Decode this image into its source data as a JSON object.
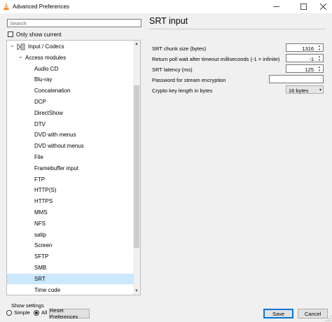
{
  "window": {
    "title": "Advanced Preferences"
  },
  "search": {
    "placeholder": "Search"
  },
  "only_show_current": "Only show current",
  "tree": {
    "items": [
      {
        "label": "Input / Codecs",
        "level": 1,
        "expanded": true,
        "icon": "codec-icon"
      },
      {
        "label": "Access modules",
        "level": 2,
        "expanded": true
      },
      {
        "label": "Audio CD",
        "level": 3
      },
      {
        "label": "Blu-ray",
        "level": 3
      },
      {
        "label": "Concatenation",
        "level": 3
      },
      {
        "label": "DCP",
        "level": 3
      },
      {
        "label": "DirectShow",
        "level": 3
      },
      {
        "label": "DTV",
        "level": 3
      },
      {
        "label": "DVD with menus",
        "level": 3
      },
      {
        "label": "DVD without menus",
        "level": 3
      },
      {
        "label": "File",
        "level": 3
      },
      {
        "label": "Framebuffer input",
        "level": 3
      },
      {
        "label": "FTP",
        "level": 3
      },
      {
        "label": "HTTP(S)",
        "level": 3
      },
      {
        "label": "HTTPS",
        "level": 3
      },
      {
        "label": "MMS",
        "level": 3
      },
      {
        "label": "NFS",
        "level": 3
      },
      {
        "label": "satip",
        "level": 3
      },
      {
        "label": "Screen",
        "level": 3
      },
      {
        "label": "SFTP",
        "level": 3
      },
      {
        "label": "SMB",
        "level": 3
      },
      {
        "label": "SRT",
        "level": 3,
        "selected": true
      },
      {
        "label": "Time code",
        "level": 3
      }
    ]
  },
  "panel": {
    "title": "SRT input",
    "chunk_size": {
      "label": "SRT chunk size (bytes)",
      "value": "1316"
    },
    "poll_wait": {
      "label": "Return poll wait after timeout milliseconds (-1 = infinite)",
      "value": "-1"
    },
    "latency": {
      "label": "SRT latency (ms)",
      "value": "125"
    },
    "password": {
      "label": "Password for stream encryption",
      "value": ""
    },
    "key_length": {
      "label": "Crypto key length in bytes",
      "value": "16 bytes"
    }
  },
  "footer": {
    "show_settings": "Show settings",
    "simple": "Simple",
    "all": "All",
    "selected_mode": "All",
    "reset": "Reset Preferences",
    "save": "Save",
    "cancel": "Cancel"
  },
  "colors": {
    "selection": "#cce8ff",
    "default_button_border": "#0078d7"
  }
}
